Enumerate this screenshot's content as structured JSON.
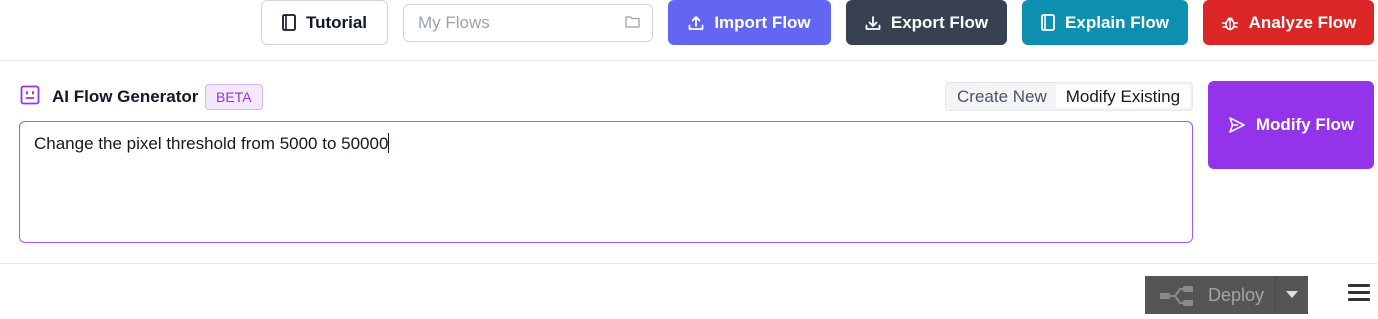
{
  "toolbar": {
    "tutorial_label": "Tutorial",
    "flows_placeholder": "My Flows",
    "import_label": "Import Flow",
    "export_label": "Export Flow",
    "explain_label": "Explain Flow",
    "analyze_label": "Analyze Flow"
  },
  "generator": {
    "title": "AI Flow Generator",
    "badge": "BETA",
    "modes": [
      "Create New",
      "Modify Existing"
    ],
    "active_mode": "Modify Existing",
    "prompt_value": "Change the pixel threshold from 5000 to 50000",
    "action_label": "Modify Flow"
  },
  "deploy": {
    "label": "Deploy"
  },
  "icons": {
    "tutorial": "book-icon",
    "flows": "folder-icon",
    "import": "upload-icon",
    "export": "download-icon",
    "explain": "book-icon",
    "analyze": "bug-icon",
    "generator": "robot-icon",
    "modify": "send-icon",
    "deploy": "deploy-icon",
    "menu": "hamburger-menu-icon"
  },
  "colors": {
    "import": "#6366f1",
    "export": "#374151",
    "explain": "#0e8fb0",
    "analyze": "#dc2626",
    "accent": "#9333ea",
    "deploy": "#555555"
  }
}
